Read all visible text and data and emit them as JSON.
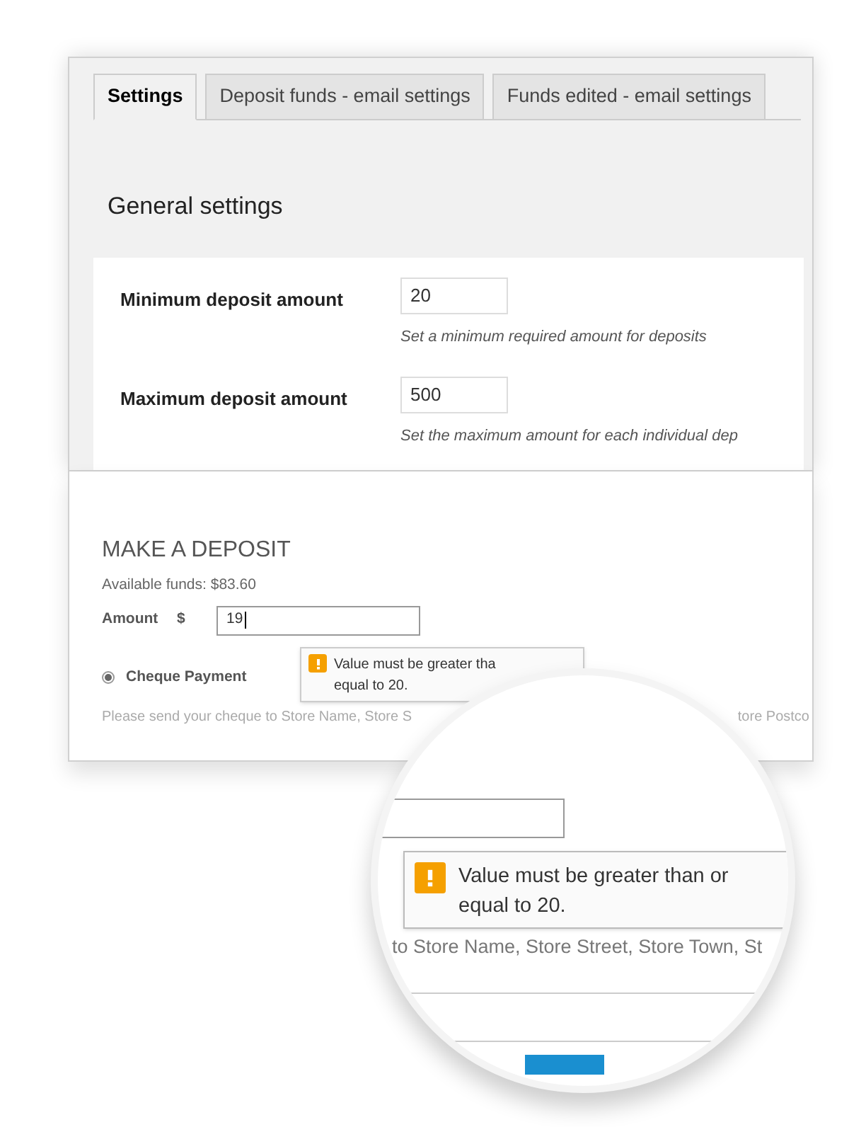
{
  "settings_panel": {
    "tabs": [
      {
        "label": "Settings",
        "selected": true
      },
      {
        "label": "Deposit funds - email settings",
        "selected": false
      },
      {
        "label": "Funds edited - email settings",
        "selected": false
      }
    ],
    "heading": "General settings",
    "fields": [
      {
        "label": "Minimum deposit amount",
        "value": "20",
        "hint": "Set a minimum required amount for deposits"
      },
      {
        "label": "Maximum deposit amount",
        "value": "500",
        "hint": "Set the maximum amount for each individual dep"
      }
    ]
  },
  "deposit_form": {
    "title": "MAKE A DEPOSIT",
    "available_funds": "Available funds: $83.60",
    "amount": {
      "label": "Amount",
      "currency": "$",
      "value": "19"
    },
    "tooltip": {
      "lines": [
        "Value must be greater tha",
        "equal to 20."
      ]
    },
    "payment_methods": [
      {
        "label": "Cheque Payment",
        "selected": true
      }
    ],
    "cheque_note": [
      "Please send your cheque to Store Name, Store S",
      "tore Postco"
    ]
  },
  "magnifier": {
    "tooltip": {
      "lines": [
        "Value must be greater than or",
        "equal to 20."
      ]
    },
    "cheque_note": "to Store Name, Store Street, Store Town, St"
  }
}
